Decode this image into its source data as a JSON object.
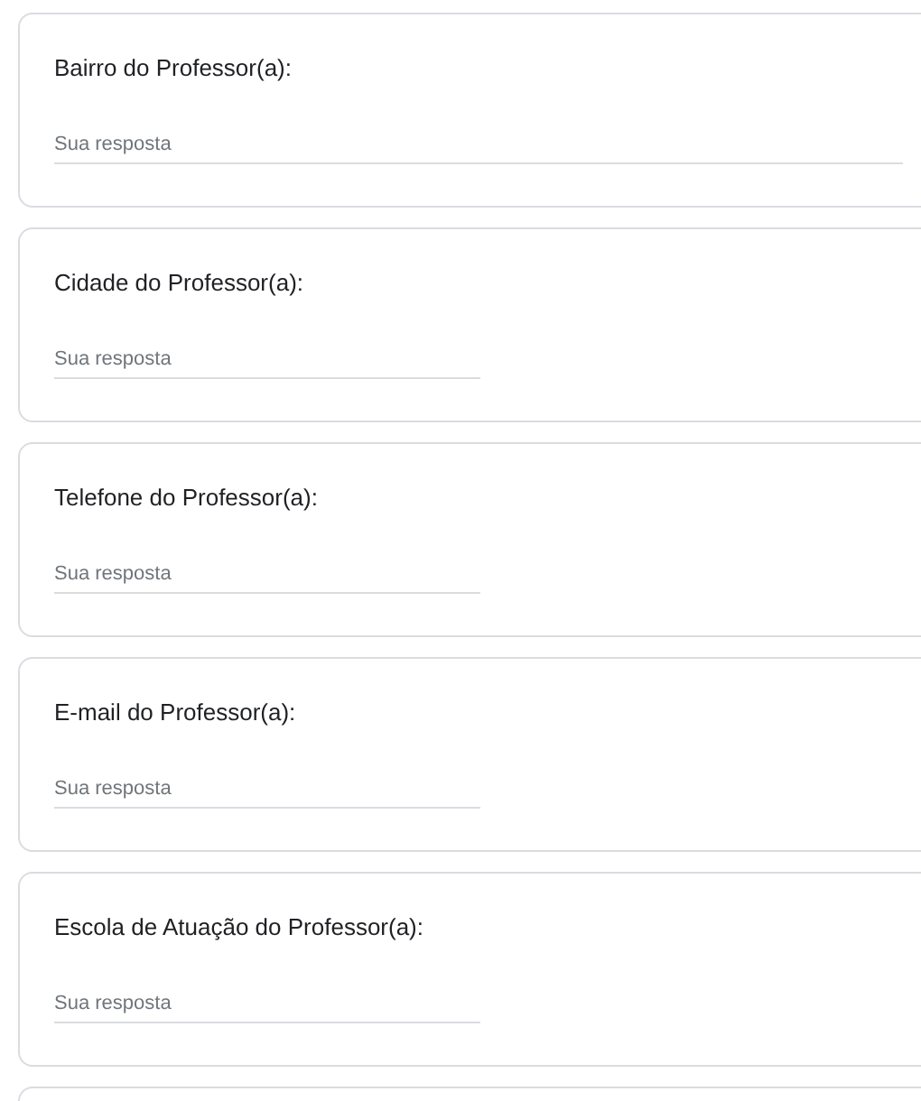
{
  "questions": [
    {
      "label": "Bairro do Professor(a):",
      "placeholder": "Sua resposta",
      "kind": "wide"
    },
    {
      "label": "Cidade do Professor(a):",
      "placeholder": "Sua resposta",
      "kind": "narrow"
    },
    {
      "label": "Telefone do Professor(a):",
      "placeholder": "Sua resposta",
      "kind": "narrow"
    },
    {
      "label": "E-mail do Professor(a):",
      "placeholder": "Sua resposta",
      "kind": "narrow"
    },
    {
      "label": "Escola de Atuação do Professor(a):",
      "placeholder": "Sua resposta",
      "kind": "narrow"
    }
  ]
}
